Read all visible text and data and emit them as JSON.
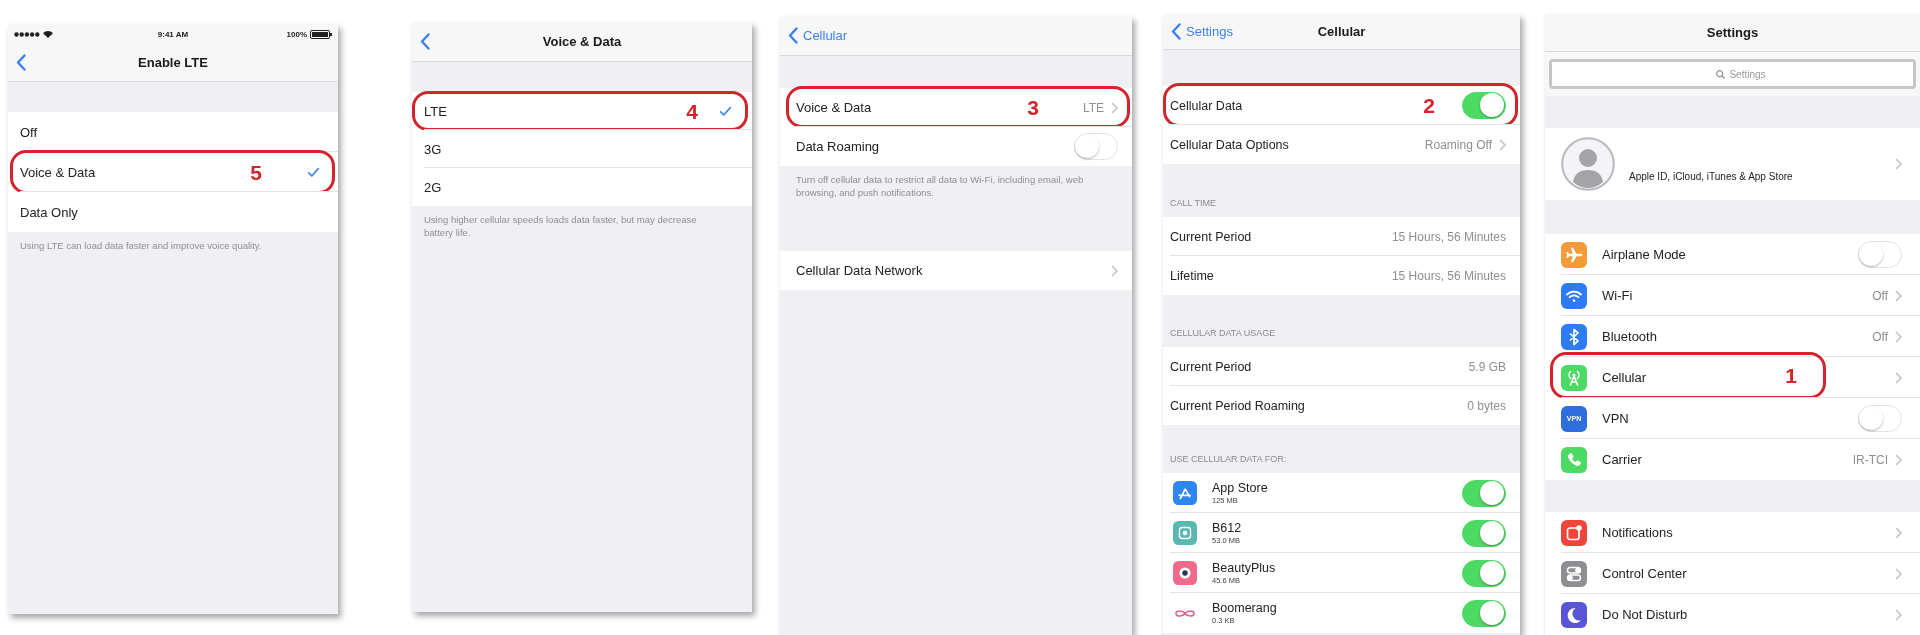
{
  "screens": [
    {
      "status_bar": {
        "time": "9:41 AM",
        "battery": "100%"
      },
      "nav": {
        "back": true,
        "title": "Enable LTE"
      },
      "groups": [
        {
          "rows": [
            {
              "kind": "option",
              "label": "Off",
              "selected": false
            },
            {
              "kind": "option",
              "label": "Voice & Data",
              "selected": true,
              "step": "5"
            },
            {
              "kind": "option",
              "label": "Data Only",
              "selected": false
            }
          ],
          "footer": "Using LTE can load data faster and improve voice quality."
        }
      ]
    },
    {
      "nav": {
        "back": true,
        "title": "Voice & Data"
      },
      "groups": [
        {
          "rows": [
            {
              "kind": "option",
              "label": "LTE",
              "selected": true,
              "step": "4"
            },
            {
              "kind": "option",
              "label": "3G",
              "selected": false
            },
            {
              "kind": "option",
              "label": "2G",
              "selected": false
            }
          ],
          "footer": "Using higher cellular speeds loads data faster, but may decrease battery life."
        }
      ]
    },
    {
      "nav": {
        "back": true,
        "back_label": "Cellular"
      },
      "groups": [
        {
          "rows": [
            {
              "kind": "link",
              "label": "Voice & Data",
              "value": "LTE",
              "step": "3"
            },
            {
              "kind": "toggle",
              "label": "Data Roaming",
              "on": false
            }
          ],
          "footer": "Turn off cellular data to restrict all data to Wi-Fi, including email, web browsing, and push notifications."
        },
        {
          "rows": [
            {
              "kind": "link",
              "label": "Cellular Data Network"
            }
          ]
        }
      ]
    },
    {
      "nav": {
        "back": true,
        "back_label": "Settings",
        "title": "Cellular"
      },
      "groups": [
        {
          "rows": [
            {
              "kind": "toggle",
              "label": "Cellular Data",
              "on": true,
              "step": "2"
            },
            {
              "kind": "link",
              "label": "Cellular Data Options",
              "value": "Roaming Off"
            }
          ]
        },
        {
          "header": "CALL TIME",
          "rows": [
            {
              "kind": "value",
              "label": "Current Period",
              "value": "15 Hours, 56 Minutes"
            },
            {
              "kind": "value",
              "label": "Lifetime",
              "value": "15 Hours, 56 Minutes"
            }
          ]
        },
        {
          "header": "CELLULAR DATA USAGE",
          "rows": [
            {
              "kind": "value",
              "label": "Current Period",
              "value": "5.9 GB"
            },
            {
              "kind": "value",
              "label": "Current Period Roaming",
              "value": "0 bytes"
            }
          ]
        },
        {
          "header": "USE CELLULAR DATA FOR:",
          "rows": [
            {
              "kind": "app",
              "label": "App Store",
              "detail": "125 MB",
              "on": true,
              "color": "#2f86f0"
            },
            {
              "kind": "app",
              "label": "B612",
              "detail": "53.0 MB",
              "on": true,
              "color": "#5bb8b0"
            },
            {
              "kind": "app",
              "label": "BeautyPlus",
              "detail": "45.6 MB",
              "on": true,
              "color": "#f06a8a"
            },
            {
              "kind": "app",
              "label": "Boomerang",
              "detail": "0.3 KB",
              "on": true,
              "color": "#e0608a"
            }
          ]
        }
      ]
    },
    {
      "nav": {
        "back": false,
        "title": "Settings"
      },
      "search": {
        "placeholder": "Settings"
      },
      "groups": [
        {
          "rows": [
            {
              "kind": "profile",
              "label": "Apple ID, iCloud, iTunes & App Store"
            }
          ]
        },
        {
          "rows": [
            {
              "kind": "toggle",
              "label": "Airplane Mode",
              "on": false,
              "color": "#f29b38"
            },
            {
              "kind": "link",
              "label": "Wi-Fi",
              "value": "Off",
              "color": "#2d7cf6"
            },
            {
              "kind": "link",
              "label": "Bluetooth",
              "value": "Off",
              "color": "#2d7cf6"
            },
            {
              "kind": "link",
              "label": "Cellular",
              "color": "#4cd964",
              "step": "1"
            },
            {
              "kind": "toggle",
              "label": "VPN",
              "on": false,
              "color": "#2e6fdc",
              "icon_label": "VPN"
            },
            {
              "kind": "link",
              "label": "Carrier",
              "value": "IR-TCI",
              "color": "#4cd964"
            }
          ]
        },
        {
          "rows": [
            {
              "kind": "link",
              "label": "Notifications",
              "color": "#f0453a"
            },
            {
              "kind": "link",
              "label": "Control Center",
              "color": "#8e8e93"
            },
            {
              "kind": "link",
              "label": "Do Not Disturb",
              "color": "#5856d6"
            }
          ]
        }
      ]
    }
  ]
}
